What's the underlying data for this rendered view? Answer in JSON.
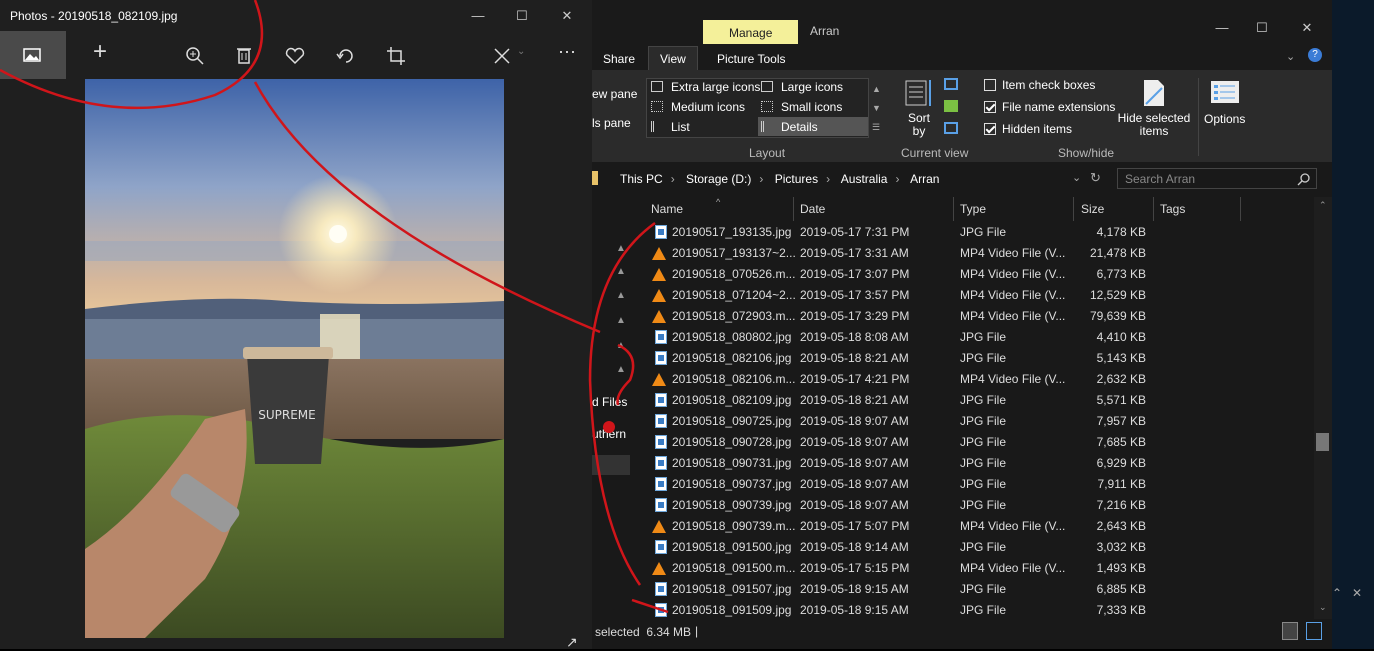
{
  "photos": {
    "title": "Photos - 20190518_082109.jpg",
    "toolbar": [
      "image-icon",
      "add-icon",
      "zoom-icon",
      "delete-icon",
      "heart-icon",
      "rotate-icon",
      "crop-icon",
      "edit-icon",
      "more-icon"
    ],
    "photo_text": "SUPREME"
  },
  "explorer": {
    "tabs": {
      "manage": "Manage",
      "window_title": "Arran",
      "share": "Share",
      "view": "View",
      "picture_tools": "Picture Tools"
    },
    "pane": {
      "preview": "ew pane",
      "details": "ls pane"
    },
    "layout": {
      "extra_large": "Extra large icons",
      "large": "Large icons",
      "medium": "Medium icons",
      "small": "Small icons",
      "list": "List",
      "details": "Details",
      "group": "Layout"
    },
    "current_view": {
      "sort_by": "Sort by",
      "group": "Current view"
    },
    "show_hide": {
      "item_check_boxes": "Item check boxes",
      "file_name_extensions": "File name extensions",
      "hidden_items": "Hidden items",
      "hide_selected": "Hide selected items",
      "group": "Show/hide"
    },
    "options": "Options",
    "breadcrumbs": [
      "This PC",
      "Storage (D:)",
      "Pictures",
      "Australia",
      "Arran"
    ],
    "search_placeholder": "Search Arran",
    "columns": {
      "name": "Name",
      "date": "Date",
      "type": "Type",
      "size": "Size",
      "tags": "Tags"
    },
    "nav_labels": [
      "d Files",
      "uthern"
    ],
    "files": [
      {
        "name": "20190517_193135.jpg",
        "date": "2019-05-17 7:31 PM",
        "type": "JPG File",
        "size": "4,178 KB",
        "kind": "jpg"
      },
      {
        "name": "20190517_193137~2...",
        "date": "2019-05-17 3:31 AM",
        "type": "MP4 Video File (V...",
        "size": "21,478 KB",
        "kind": "vid"
      },
      {
        "name": "20190518_070526.m...",
        "date": "2019-05-17 3:07 PM",
        "type": "MP4 Video File (V...",
        "size": "6,773 KB",
        "kind": "vid"
      },
      {
        "name": "20190518_071204~2...",
        "date": "2019-05-17 3:57 PM",
        "type": "MP4 Video File (V...",
        "size": "12,529 KB",
        "kind": "vid"
      },
      {
        "name": "20190518_072903.m...",
        "date": "2019-05-17 3:29 PM",
        "type": "MP4 Video File (V...",
        "size": "79,639 KB",
        "kind": "vid"
      },
      {
        "name": "20190518_080802.jpg",
        "date": "2019-05-18 8:08 AM",
        "type": "JPG File",
        "size": "4,410 KB",
        "kind": "jpg"
      },
      {
        "name": "20190518_082106.jpg",
        "date": "2019-05-18 8:21 AM",
        "type": "JPG File",
        "size": "5,143 KB",
        "kind": "jpg"
      },
      {
        "name": "20190518_082106.m...",
        "date": "2019-05-17 4:21 PM",
        "type": "MP4 Video File (V...",
        "size": "2,632 KB",
        "kind": "vid"
      },
      {
        "name": "20190518_082109.jpg",
        "date": "2019-05-18 8:21 AM",
        "type": "JPG File",
        "size": "5,571 KB",
        "kind": "jpg"
      },
      {
        "name": "20190518_090725.jpg",
        "date": "2019-05-18 9:07 AM",
        "type": "JPG File",
        "size": "7,957 KB",
        "kind": "jpg"
      },
      {
        "name": "20190518_090728.jpg",
        "date": "2019-05-18 9:07 AM",
        "type": "JPG File",
        "size": "7,685 KB",
        "kind": "jpg"
      },
      {
        "name": "20190518_090731.jpg",
        "date": "2019-05-18 9:07 AM",
        "type": "JPG File",
        "size": "6,929 KB",
        "kind": "jpg"
      },
      {
        "name": "20190518_090737.jpg",
        "date": "2019-05-18 9:07 AM",
        "type": "JPG File",
        "size": "7,911 KB",
        "kind": "jpg"
      },
      {
        "name": "20190518_090739.jpg",
        "date": "2019-05-18 9:07 AM",
        "type": "JPG File",
        "size": "7,216 KB",
        "kind": "jpg"
      },
      {
        "name": "20190518_090739.m...",
        "date": "2019-05-17 5:07 PM",
        "type": "MP4 Video File (V...",
        "size": "2,643 KB",
        "kind": "vid"
      },
      {
        "name": "20190518_091500.jpg",
        "date": "2019-05-18 9:14 AM",
        "type": "JPG File",
        "size": "3,032 KB",
        "kind": "jpg"
      },
      {
        "name": "20190518_091500.m...",
        "date": "2019-05-17 5:15 PM",
        "type": "MP4 Video File (V...",
        "size": "1,493 KB",
        "kind": "vid"
      },
      {
        "name": "20190518_091507.jpg",
        "date": "2019-05-18 9:15 AM",
        "type": "JPG File",
        "size": "6,885 KB",
        "kind": "jpg"
      },
      {
        "name": "20190518_091509.jpg",
        "date": "2019-05-18 9:15 AM",
        "type": "JPG File",
        "size": "7,333 KB",
        "kind": "jpg"
      }
    ],
    "status": "selected  6.34 MB"
  }
}
